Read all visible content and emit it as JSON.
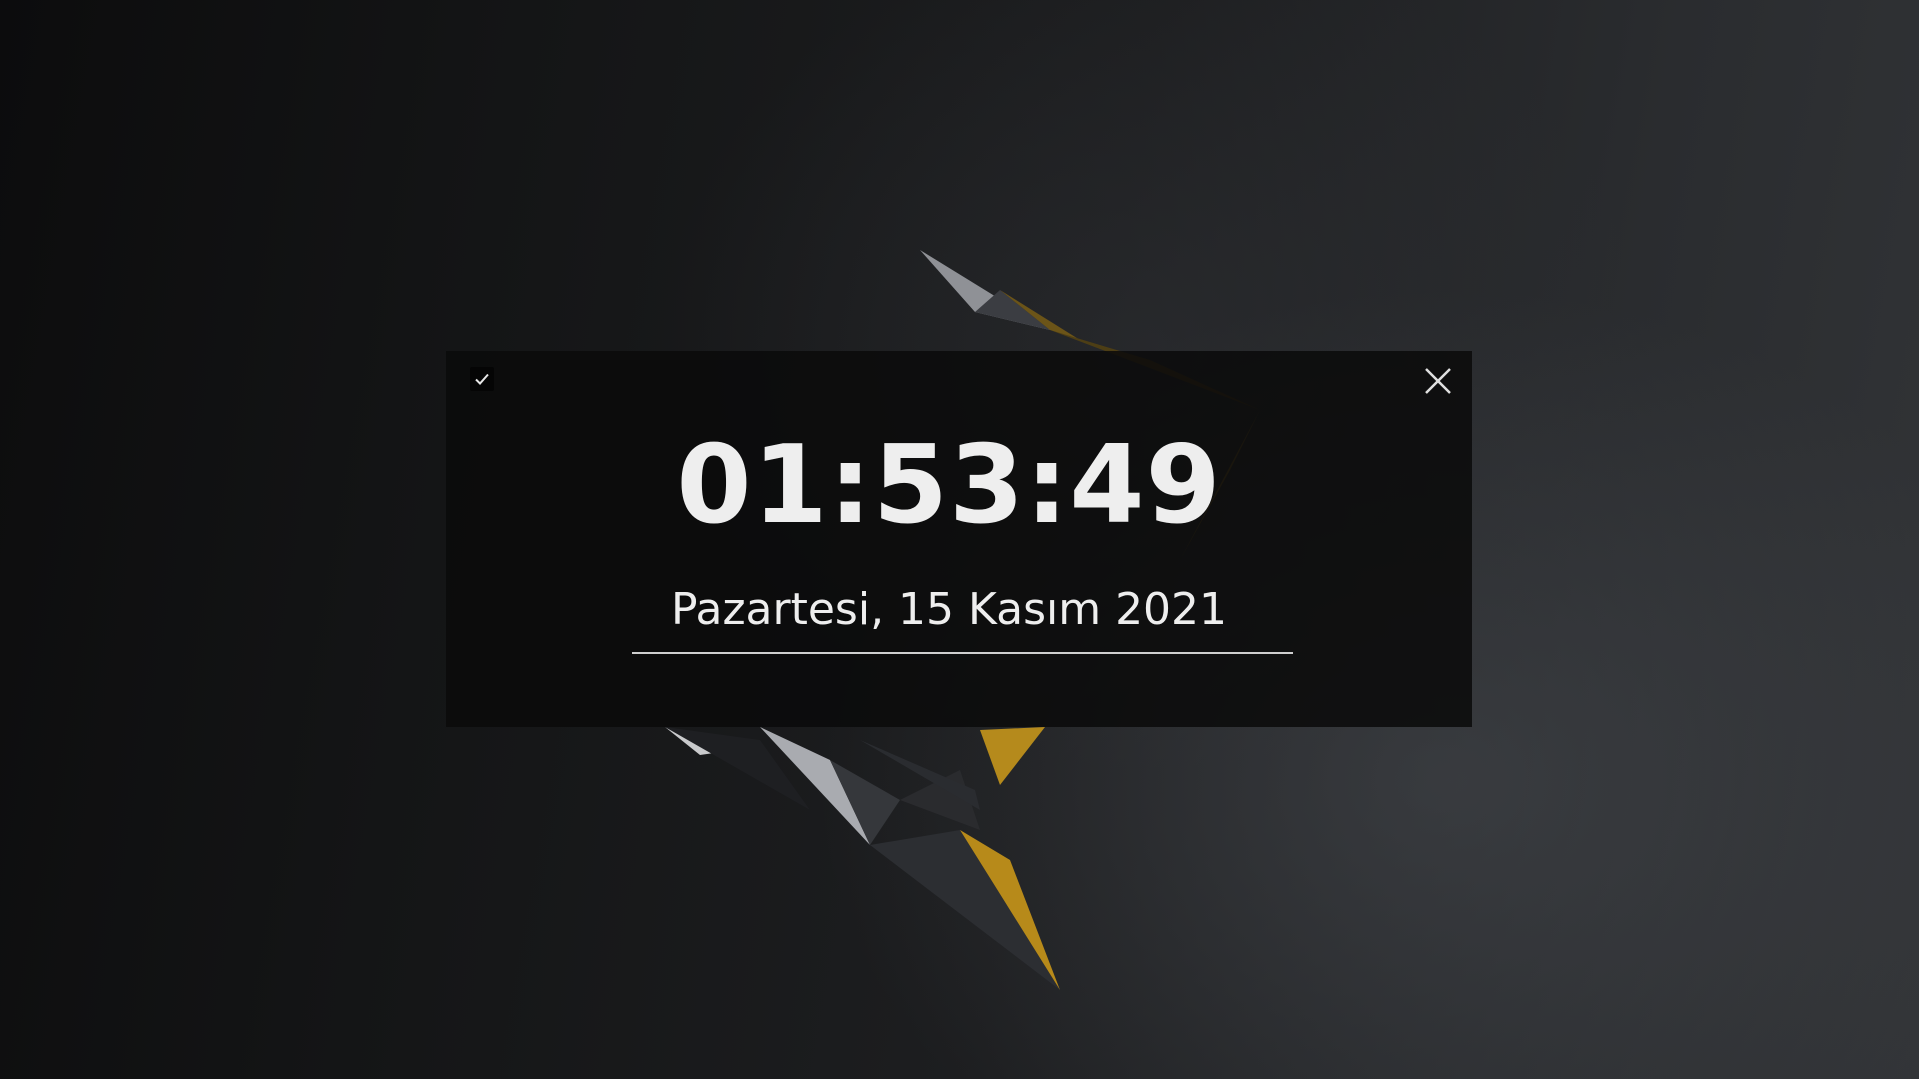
{
  "clock": {
    "time": "01:53:49",
    "date": "Pazartesi, 15 Kasım 2021"
  },
  "controls": {
    "pin_icon": "checkmark-icon",
    "close_icon": "close-icon"
  },
  "colors": {
    "text": "#eeeeee",
    "panel": "#0a0a0a",
    "accent": "#c99a1a"
  }
}
